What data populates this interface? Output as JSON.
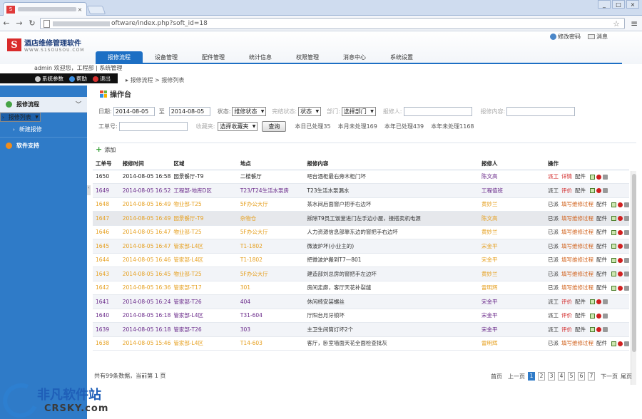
{
  "browser": {
    "url": "oftware/index.php?soft_id=18",
    "tab_close": "×",
    "win_buttons": [
      "_",
      "□",
      "×"
    ]
  },
  "header": {
    "logo_letter": "S",
    "app_name": "酒店维修管理软件",
    "site": "WWW.S1SOUSOU.COM",
    "change_password": "修改密码",
    "messages": "消息",
    "nav_tabs": [
      "报修流程",
      "设备管理",
      "配件管理",
      "统计信息",
      "权限管理",
      "消息中心",
      "系统设置"
    ],
    "active_tab": 0
  },
  "user_line": "admin 欢迎您，工程部 | 系统管理",
  "quickbar": {
    "params": "系统参数",
    "help": "帮助",
    "logout": "退出"
  },
  "breadcrumb": "报修流程 > 报修列表",
  "sidebar": {
    "section": "报修流程",
    "items": [
      "报修列表",
      "新建报修"
    ],
    "support": "软件支持"
  },
  "main": {
    "title": "操作台",
    "filters": {
      "date_label": "日期:",
      "date_from": "2014-08-05",
      "to": "至",
      "date_to": "2014-08-05",
      "status_label": "状态:",
      "status_value": "维修状态",
      "done_label": "完结状态:",
      "done_value": "状态",
      "dept_label": "部门:",
      "dept_value": "选择部门",
      "reporter_label": "报修人:",
      "content_label": "报修内容:",
      "order_label": "工单号:",
      "fav_label": "收藏夹:",
      "fav_value": "选择收藏夹",
      "query": "查询",
      "stats": [
        "本日已处理35",
        "本月未处理169",
        "本年已处理439",
        "本年未处理1168"
      ]
    },
    "add": "添加",
    "columns": [
      "工单号",
      "报修时间",
      "区域",
      "地点",
      "报修内容",
      "报修人",
      "操作"
    ],
    "rows": [
      {
        "id": "1650",
        "time": "2014-08-05 16:58",
        "area": "园景餐厅-T9",
        "place": "二楼餐厅",
        "content": "吧台酒柜最右旁木柜门坏",
        "person": "陈文高",
        "ops": [
          "派工",
          "详情",
          "配件"
        ],
        "style": "c-dark",
        "bg": "",
        "color1": "op-a",
        "color2": "op-a"
      },
      {
        "id": "1649",
        "time": "2014-08-05 16:52",
        "area": "工程部-地库D区",
        "place": "T23/T24生活水泵房",
        "content": "T23生活水泵漏水",
        "person": "工程值班",
        "ops": [
          "派工",
          "评价",
          "配件"
        ],
        "style": "c-purple",
        "bg": "alt",
        "color1": "op-b",
        "color2": "op-a"
      },
      {
        "id": "1648",
        "time": "2014-08-05 16:49",
        "area": "物业部-T25",
        "place": "5F办公大厅",
        "content": "茶水间后面窗户把手右边坏",
        "person": "黄妙兰",
        "ops": [
          "已派",
          "填写维修过程",
          "配件"
        ],
        "style": "c-orange",
        "bg": "",
        "color1": "op-b",
        "color2": "op-c"
      },
      {
        "id": "1647",
        "time": "2014-08-05 16:49",
        "area": "园景餐厅-T9",
        "place": "杂物仓",
        "content": "拆除T9员工饭堂进门左手边小屋，接搭卖机电源",
        "person": "陈文高",
        "ops": [
          "已派",
          "填写维修过程",
          "配件"
        ],
        "style": "c-orange",
        "bg": "gray",
        "color1": "op-b",
        "color2": "op-c"
      },
      {
        "id": "1646",
        "time": "2014-08-05 16:47",
        "area": "物业部-T25",
        "place": "5F办公大厅",
        "content": "人力资源信息部靠东边的窗把手右边坏",
        "person": "黄妙兰",
        "ops": [
          "已派",
          "填写维修过程",
          "配件"
        ],
        "style": "c-orange",
        "bg": "",
        "color1": "op-b",
        "color2": "op-c"
      },
      {
        "id": "1645",
        "time": "2014-08-05 16:47",
        "area": "管家部-L4区",
        "place": "T1-1802",
        "content": "微波炉坏(小业主的)",
        "person": "宋金平",
        "ops": [
          "已派",
          "填写维修过程",
          "配件"
        ],
        "style": "c-orange",
        "bg": "alt",
        "color1": "op-b",
        "color2": "op-c"
      },
      {
        "id": "1644",
        "time": "2014-08-05 16:46",
        "area": "管家部-L4区",
        "place": "T1-1802",
        "content": "把微波炉搬到T7—801",
        "person": "宋金平",
        "ops": [
          "已派",
          "填写维修过程",
          "配件"
        ],
        "style": "c-orange",
        "bg": "",
        "color1": "op-b",
        "color2": "op-c"
      },
      {
        "id": "1643",
        "time": "2014-08-05 16:45",
        "area": "物业部-T25",
        "place": "5F办公大厅",
        "content": "建造部刘总房的窗把手左边坏",
        "person": "黄妙兰",
        "ops": [
          "已派",
          "填写维修过程",
          "配件"
        ],
        "style": "c-orange",
        "bg": "alt",
        "color1": "op-b",
        "color2": "op-c"
      },
      {
        "id": "1642",
        "time": "2014-08-05 16:36",
        "area": "管家部-T17",
        "place": "301",
        "content": "房间走廊，客厅天花补裂缝",
        "person": "雷明辉",
        "ops": [
          "已派",
          "填写维修过程",
          "配件"
        ],
        "style": "c-orange",
        "bg": "",
        "color1": "op-b",
        "color2": "op-c"
      },
      {
        "id": "1641",
        "time": "2014-08-05 16:24",
        "area": "管家部-T26",
        "place": "404",
        "content": "休闲椅安装螺丝",
        "person": "宋金平",
        "ops": [
          "派工",
          "评价",
          "配件"
        ],
        "style": "c-purple",
        "bg": "alt",
        "color1": "op-b",
        "color2": "op-a"
      },
      {
        "id": "1640",
        "time": "2014-08-05 16:18",
        "area": "管家部-L4区",
        "place": "T31-604",
        "content": "厅阳台月牙锁坏",
        "person": "宋金平",
        "ops": [
          "派工",
          "评价",
          "配件"
        ],
        "style": "c-purple",
        "bg": "",
        "color1": "op-b",
        "color2": "op-a"
      },
      {
        "id": "1639",
        "time": "2014-08-05 16:18",
        "area": "管家部-T26",
        "place": "303",
        "content": "主卫生间筒灯坏2个",
        "person": "宋金平",
        "ops": [
          "派工",
          "评价",
          "配件"
        ],
        "style": "c-purple",
        "bg": "alt",
        "color1": "op-b",
        "color2": "op-a"
      },
      {
        "id": "1638",
        "time": "2014-08-05 15:46",
        "area": "管家部-L4区",
        "place": "T14-603",
        "content": "客厅，卧室墙面天花全面检查批灰",
        "person": "雷明辉",
        "ops": [
          "已派",
          "填写维修过程",
          "配件"
        ],
        "style": "c-orange",
        "bg": "",
        "color1": "op-b",
        "color2": "op-c"
      }
    ],
    "footer_summary": "共有99条数据，当前第 1 页",
    "pager": {
      "first": "首页",
      "prev": "上一页",
      "pages": [
        "1",
        "2",
        "3",
        "4",
        "5",
        "6",
        "7"
      ],
      "current": 0,
      "next": "下一页",
      "last": "尾页"
    }
  },
  "watermark": {
    "cn": "非凡软件站",
    "en": "CRSKY.com"
  }
}
